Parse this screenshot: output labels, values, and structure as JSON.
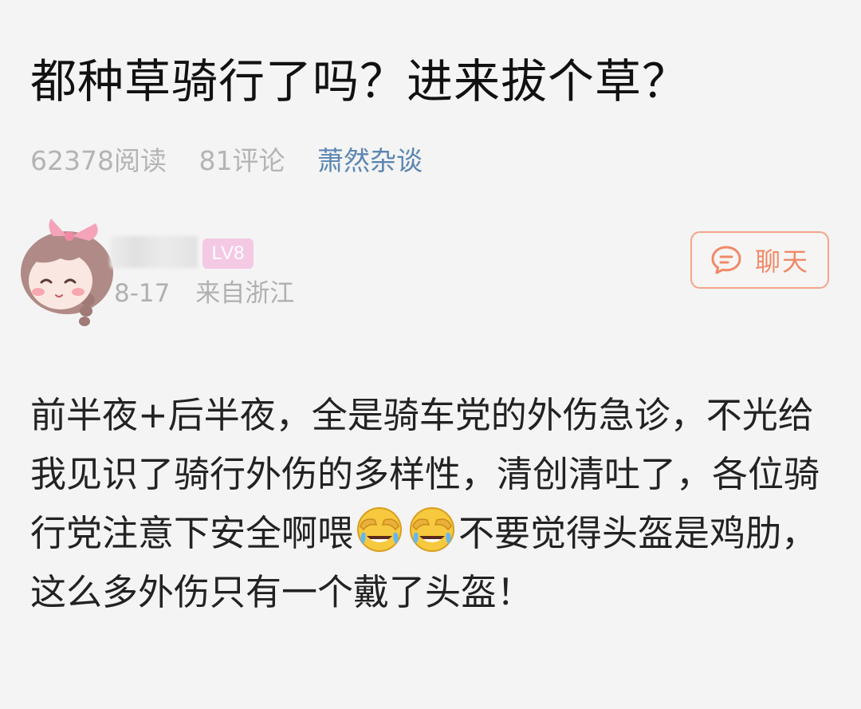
{
  "article": {
    "title": "都种草骑行了吗？进来拔个草？",
    "reads": "62378阅读",
    "comments": "81评论",
    "channel": "萧然杂谈"
  },
  "author": {
    "level": "LV8",
    "date": "8-17",
    "location": "来自浙江"
  },
  "actions": {
    "chat_label": "聊天",
    "chat_icon": "chat-bubble-icon"
  },
  "post": {
    "text_before": "前半夜+后半夜，全是骑车党的外伤急诊，不光给我见识了骑行外伤的多样性，清创清吐了，各位骑行党注意下安全啊喂",
    "emoji_icon": "face-palm-crying-laughing-icon",
    "text_after": "不要觉得头盔是鸡肋，这么多外伤只有一个戴了头盔！"
  },
  "colors": {
    "background": "#f4f4f4",
    "channel": "#5b86b3",
    "accent": "#f08968",
    "badge": "#f4c9e4",
    "muted": "#b0b0b0"
  }
}
